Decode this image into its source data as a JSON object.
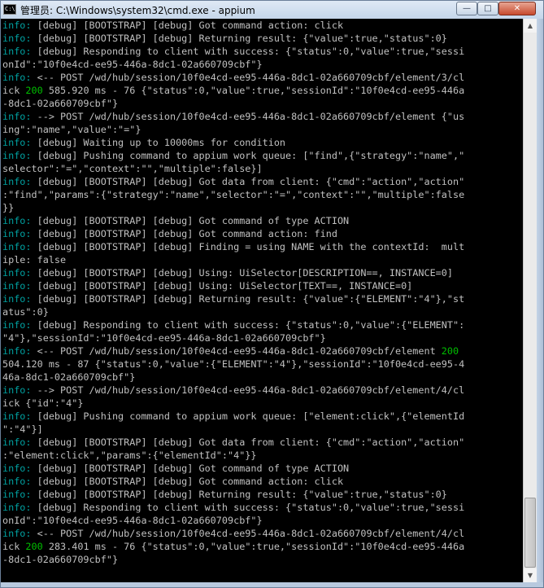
{
  "window": {
    "title": "管理员: C:\\Windows\\system32\\cmd.exe - appium",
    "icon_text": "C:\\",
    "buttons": {
      "minimize": "—",
      "maximize": "□",
      "close": "✕"
    }
  },
  "console": {
    "lines": [
      {
        "tag": "info:",
        "text": " [debug] [BOOTSTRAP] [debug] Got command action: click"
      },
      {
        "tag": "info:",
        "text": " [debug] [BOOTSTRAP] [debug] Returning result: {\"value\":true,\"status\":0}"
      },
      {
        "tag": "info:",
        "text": " [debug] Responding to client with success: {\"status\":0,\"value\":true,\"sessi"
      },
      {
        "tag": "",
        "text": "onId\":\"10f0e4cd-ee95-446a-8dc1-02a660709cbf\"}"
      },
      {
        "tag": "info:",
        "text": " <-- POST /wd/hub/session/10f0e4cd-ee95-446a-8dc1-02a660709cbf/element/3/cl"
      },
      {
        "tag": "",
        "text": "ick ",
        "status": "200",
        "rest": " 585.920 ms - 76 {\"status\":0,\"value\":true,\"sessionId\":\"10f0e4cd-ee95-446a"
      },
      {
        "tag": "",
        "text": "-8dc1-02a660709cbf\"}"
      },
      {
        "tag": "info:",
        "text": " --> POST /wd/hub/session/10f0e4cd-ee95-446a-8dc1-02a660709cbf/element {\"us"
      },
      {
        "tag": "",
        "text": "ing\":\"name\",\"value\":\"=\"}"
      },
      {
        "tag": "info:",
        "text": " [debug] Waiting up to 10000ms for condition"
      },
      {
        "tag": "info:",
        "text": " [debug] Pushing command to appium work queue: [\"find\",{\"strategy\":\"name\",\""
      },
      {
        "tag": "",
        "text": "selector\":\"=\",\"context\":\"\",\"multiple\":false}]"
      },
      {
        "tag": "info:",
        "text": " [debug] [BOOTSTRAP] [debug] Got data from client: {\"cmd\":\"action\",\"action\""
      },
      {
        "tag": "",
        "text": ":\"find\",\"params\":{\"strategy\":\"name\",\"selector\":\"=\",\"context\":\"\",\"multiple\":false"
      },
      {
        "tag": "",
        "text": "}}"
      },
      {
        "tag": "info:",
        "text": " [debug] [BOOTSTRAP] [debug] Got command of type ACTION"
      },
      {
        "tag": "info:",
        "text": " [debug] [BOOTSTRAP] [debug] Got command action: find"
      },
      {
        "tag": "info:",
        "text": " [debug] [BOOTSTRAP] [debug] Finding = using NAME with the contextId:  mult"
      },
      {
        "tag": "",
        "text": "iple: false"
      },
      {
        "tag": "info:",
        "text": " [debug] [BOOTSTRAP] [debug] Using: UiSelector[DESCRIPTION==, INSTANCE=0]"
      },
      {
        "tag": "info:",
        "text": " [debug] [BOOTSTRAP] [debug] Using: UiSelector[TEXT==, INSTANCE=0]"
      },
      {
        "tag": "info:",
        "text": " [debug] [BOOTSTRAP] [debug] Returning result: {\"value\":{\"ELEMENT\":\"4\"},\"st"
      },
      {
        "tag": "",
        "text": "atus\":0}"
      },
      {
        "tag": "info:",
        "text": " [debug] Responding to client with success: {\"status\":0,\"value\":{\"ELEMENT\":"
      },
      {
        "tag": "",
        "text": "\"4\"},\"sessionId\":\"10f0e4cd-ee95-446a-8dc1-02a660709cbf\"}"
      },
      {
        "tag": "info:",
        "text": " <-- POST /wd/hub/session/10f0e4cd-ee95-446a-8dc1-02a660709cbf/element ",
        "status": "200",
        "rest": ""
      },
      {
        "tag": "",
        "text": "504.120 ms - 87 {\"status\":0,\"value\":{\"ELEMENT\":\"4\"},\"sessionId\":\"10f0e4cd-ee95-4"
      },
      {
        "tag": "",
        "text": "46a-8dc1-02a660709cbf\"}"
      },
      {
        "tag": "info:",
        "text": " --> POST /wd/hub/session/10f0e4cd-ee95-446a-8dc1-02a660709cbf/element/4/cl"
      },
      {
        "tag": "",
        "text": "ick {\"id\":\"4\"}"
      },
      {
        "tag": "info:",
        "text": " [debug] Pushing command to appium work queue: [\"element:click\",{\"elementId"
      },
      {
        "tag": "",
        "text": "\":\"4\"}]"
      },
      {
        "tag": "info:",
        "text": " [debug] [BOOTSTRAP] [debug] Got data from client: {\"cmd\":\"action\",\"action\""
      },
      {
        "tag": "",
        "text": ":\"element:click\",\"params\":{\"elementId\":\"4\"}}"
      },
      {
        "tag": "info:",
        "text": " [debug] [BOOTSTRAP] [debug] Got command of type ACTION"
      },
      {
        "tag": "info:",
        "text": " [debug] [BOOTSTRAP] [debug] Got command action: click"
      },
      {
        "tag": "info:",
        "text": " [debug] [BOOTSTRAP] [debug] Returning result: {\"value\":true,\"status\":0}"
      },
      {
        "tag": "info:",
        "text": " [debug] Responding to client with success: {\"status\":0,\"value\":true,\"sessi"
      },
      {
        "tag": "",
        "text": "onId\":\"10f0e4cd-ee95-446a-8dc1-02a660709cbf\"}"
      },
      {
        "tag": "info:",
        "text": " <-- POST /wd/hub/session/10f0e4cd-ee95-446a-8dc1-02a660709cbf/element/4/cl"
      },
      {
        "tag": "",
        "text": "ick ",
        "status": "200",
        "rest": " 283.401 ms - 76 {\"status\":0,\"value\":true,\"sessionId\":\"10f0e4cd-ee95-446a"
      },
      {
        "tag": "",
        "text": "-8dc1-02a660709cbf\"}"
      },
      {
        "tag": "",
        "text": ""
      }
    ]
  },
  "colors": {
    "console_bg": "#000000",
    "console_text": "#c0c0c0",
    "info_tag": "#00a0a0",
    "status_ok": "#00c000"
  }
}
